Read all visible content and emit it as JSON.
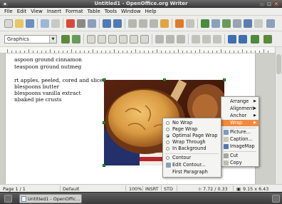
{
  "window": {
    "title": "Untitled1 - OpenOffice.org Writer"
  },
  "menubar": [
    "File",
    "Edit",
    "View",
    "Insert",
    "Format",
    "Table",
    "Tools",
    "Window",
    "Help"
  ],
  "toolbar": {
    "style_value": "Graphics"
  },
  "document": {
    "lines": [
      "aspoon ground cinnamon",
      "teaspoon ground nutmeg",
      "rt apples, peeled, cored and sliced",
      "blespoons butter",
      "blespoons vanilla extract",
      "nbaked pie crusts"
    ]
  },
  "context_menu": {
    "items": [
      {
        "label": "Arrange",
        "submenu": true
      },
      {
        "label": "Alignment",
        "submenu": true
      },
      {
        "label": "Anchor",
        "submenu": true
      },
      {
        "label": "Wrap",
        "submenu": true,
        "highlighted": true
      },
      {
        "label": "Picture..."
      },
      {
        "label": "Caption..."
      },
      {
        "label": "ImageMap"
      },
      {
        "label": "Cut"
      },
      {
        "label": "Copy"
      }
    ]
  },
  "wrap_submenu": {
    "items": [
      {
        "label": "No Wrap",
        "type": "radio",
        "checked": false
      },
      {
        "label": "Page Wrap",
        "type": "radio",
        "checked": false
      },
      {
        "label": "Optimal Page Wrap",
        "type": "radio",
        "checked": true
      },
      {
        "label": "Wrap Through",
        "type": "radio",
        "checked": false
      },
      {
        "label": "In Background",
        "type": "radio",
        "checked": false
      },
      {
        "label": "Contour",
        "type": "radio",
        "checked": false
      },
      {
        "label": "Edit Contour..."
      },
      {
        "label": "First Paragraph"
      }
    ]
  },
  "statusbar": {
    "page": "Page 1 / 1",
    "style": "Default",
    "zoom": "100%",
    "mode": "INSRT",
    "selection": "STD",
    "position": "7.72 / 0.33",
    "size": "9.15 x 6.43"
  },
  "taskbar": {
    "item": "Untitled1 - OpenOffic..."
  },
  "colors": {
    "highlight": "#f08a3c",
    "selection_handle": "#1eb52b"
  }
}
